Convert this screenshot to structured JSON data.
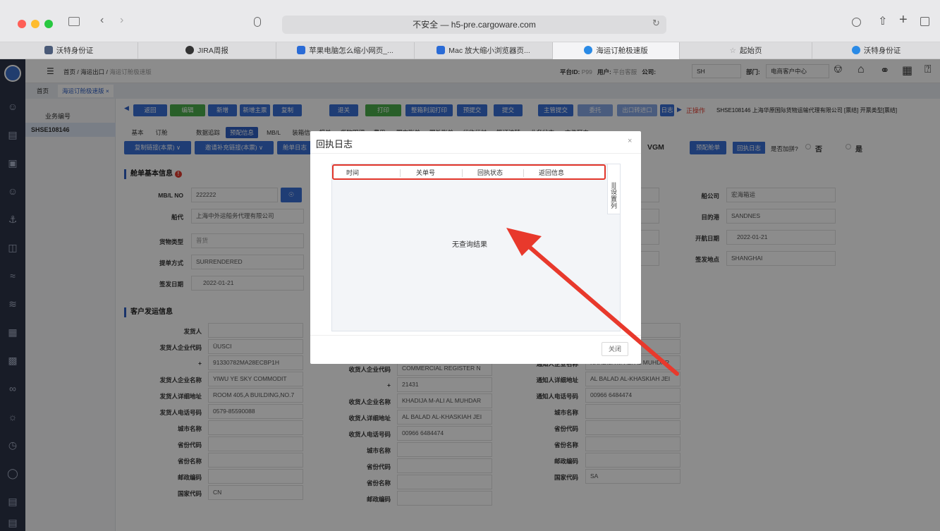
{
  "browser": {
    "address": "不安全 — h5-pre.cargoware.com",
    "tabs": [
      {
        "label": "沃特身份证",
        "color": "#4a5a78"
      },
      {
        "label": "JIRA周报",
        "color": "#333333"
      },
      {
        "label": "苹果电脑怎么缩小网页_...",
        "color": "#2a6bd6"
      },
      {
        "label": "Mac 放大缩小浏览器页...",
        "color": "#2a6bd6"
      },
      {
        "label": "海运订舱极速版",
        "color": "#2a8ae6"
      },
      {
        "label": "起始页",
        "color": "#999999"
      },
      {
        "label": "沃特身份证",
        "color": "#2a8ae6"
      }
    ]
  },
  "header": {
    "breadcrumb": [
      "首页",
      "海运出口",
      "海运订舱极速版"
    ],
    "platform_label": "平台ID:",
    "platform_id": "P99",
    "user_label": "用户:",
    "user": "平台客服",
    "company_label": "公司:",
    "company": "SH",
    "dept_label": "部门:",
    "dept": "电商客户中心"
  },
  "subtabs": [
    "首页",
    "海运订舱极速版 ×"
  ],
  "left": {
    "header": "业务编号",
    "item": "SHSE108146"
  },
  "toolbar": {
    "buttons": [
      "返回",
      "编辑",
      "新增",
      "新增主票",
      "复制",
      "退关",
      "打印",
      "整箱利润打印",
      "预提交",
      "提交",
      "主管提交",
      "委托",
      "出口转进口",
      "日志"
    ],
    "status_text": "正操作",
    "status_info": "SHSE108146  上海华原国际货物运输代理有限公司 [票结]  开票类型[票结]"
  },
  "navtabs": [
    "基本",
    "订舱",
    "数据追踪",
    "预配信息",
    "MB/L",
    "装箱信息",
    "报关",
    "货物明细",
    "费用",
    "国内账单",
    "国外账单",
    "代收代付",
    "签证流转",
    "业务状态",
    "文件区中"
  ],
  "action_row": {
    "copy_link": "复制链接(本票)",
    "invite_link": "邀请补充链接(本票)",
    "order_day": "舱单日志",
    "vgm": "VGM",
    "preplan": "预配舱单",
    "receipt_log": "回执日志",
    "merge_q": "是否加拼?",
    "no": "否",
    "yes": "是"
  },
  "section1": {
    "title": "舱单基本信息",
    "fields": [
      {
        "label": "MB/L NO",
        "value": "222222"
      },
      {
        "label": "船代",
        "value": "上海中外运船务代理有限公司"
      },
      {
        "label": "货物类型",
        "value": "普货"
      },
      {
        "label": "提单方式",
        "value": "SURRENDERED"
      },
      {
        "label": "签发日期",
        "value": "2022-01-21"
      }
    ],
    "right_fields": [
      {
        "label": "船公司",
        "value": "宏海箱运"
      },
      {
        "label": "目的港",
        "value": "SANDNES"
      },
      {
        "label": "开航日期",
        "value": "2022-01-21"
      },
      {
        "label": "签发地点",
        "value": "SHANGHAI"
      }
    ]
  },
  "section2": {
    "title": "客户发运信息",
    "col1": [
      {
        "label": "发货人",
        "value": ""
      },
      {
        "label": "发货人企业代码",
        "value": "ÜUSCI"
      },
      {
        "label": "+",
        "value": "91330782MA28ECBP1H"
      },
      {
        "label": "发货人企业名称",
        "value": "YIWU YE SKY COMMODIT"
      },
      {
        "label": "发货人详细地址",
        "value": "ROOM 405,A BUILDING,NO.7"
      },
      {
        "label": "发货人电话号码",
        "value": "0579-85590088"
      },
      {
        "label": "城市名称",
        "value": ""
      },
      {
        "label": "省份代码",
        "value": ""
      },
      {
        "label": "省份名称",
        "value": ""
      },
      {
        "label": "邮政编码",
        "value": ""
      },
      {
        "label": "国家代码",
        "value": "CN"
      }
    ],
    "col2": [
      {
        "label": "收货人企业代码",
        "value": "COMMERCIAL REGISTER N"
      },
      {
        "label": "+",
        "value": "21431"
      },
      {
        "label": "收货人企业名称",
        "value": "KHADIJA M-ALI AL MUHDAR"
      },
      {
        "label": "收货人详细地址",
        "value": "AL BALAD AL-KHASKIAH JEI"
      },
      {
        "label": "收货人电话号码",
        "value": "00966 6484474"
      },
      {
        "label": "城市名称",
        "value": ""
      },
      {
        "label": "省份代码",
        "value": ""
      },
      {
        "label": "省份名称",
        "value": ""
      },
      {
        "label": "邮政编码",
        "value": ""
      }
    ],
    "col3": [
      {
        "label": "",
        "value": "GISTER N"
      },
      {
        "label": "+",
        "value": "21431"
      },
      {
        "label": "通知人企业名称",
        "value": "KHADIJA M-ALI AL MUHDAR"
      },
      {
        "label": "通知人详细地址",
        "value": "AL BALAD AL-KHASKIAH JEI"
      },
      {
        "label": "通知人电话号码",
        "value": "00966 6484474"
      },
      {
        "label": "城市名称",
        "value": ""
      },
      {
        "label": "省份代码",
        "value": ""
      },
      {
        "label": "省份名称",
        "value": ""
      },
      {
        "label": "邮政编码",
        "value": ""
      },
      {
        "label": "国家代码",
        "value": "SA"
      }
    ]
  },
  "modal": {
    "title": "回执日志",
    "columns": [
      "时间",
      "关单号",
      "回执状态",
      "返回信息"
    ],
    "settings_col": "设置列",
    "empty": "无查询结果",
    "close": "关闭"
  }
}
